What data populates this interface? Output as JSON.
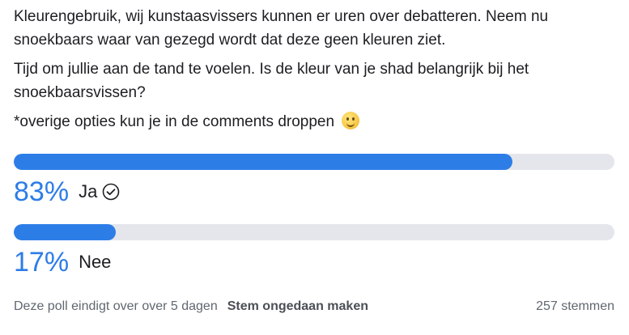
{
  "post": {
    "paragraph_1": "Kleurengebruik, wij kunstaasvissers kunnen er uren over debatteren. Neem nu snoekbaars waar van gezegd wordt dat deze geen kleuren ziet.",
    "paragraph_2": "Tijd om jullie aan de tand te voelen. Is de kleur van je shad belangrijk bij het snoekbaarsvissen?",
    "paragraph_3": "*overige opties kun je in de comments droppen",
    "emoji": "smiling-face-icon"
  },
  "poll": {
    "options": [
      {
        "percent_label": "83%",
        "percent": 83,
        "label": "Ja",
        "voted": true,
        "icon": "checkmark-circle-icon"
      },
      {
        "percent_label": "17%",
        "percent": 17,
        "label": "Nee",
        "voted": false
      }
    ],
    "footer": {
      "status": "Deze poll eindigt over over 5 dagen",
      "undo_label": "Stem ongedaan maken",
      "votes": "257 stemmen"
    }
  },
  "colors": {
    "accent": "#2d7de7",
    "track": "#e4e6eb",
    "text": "#1c1e21",
    "muted": "#606770"
  }
}
